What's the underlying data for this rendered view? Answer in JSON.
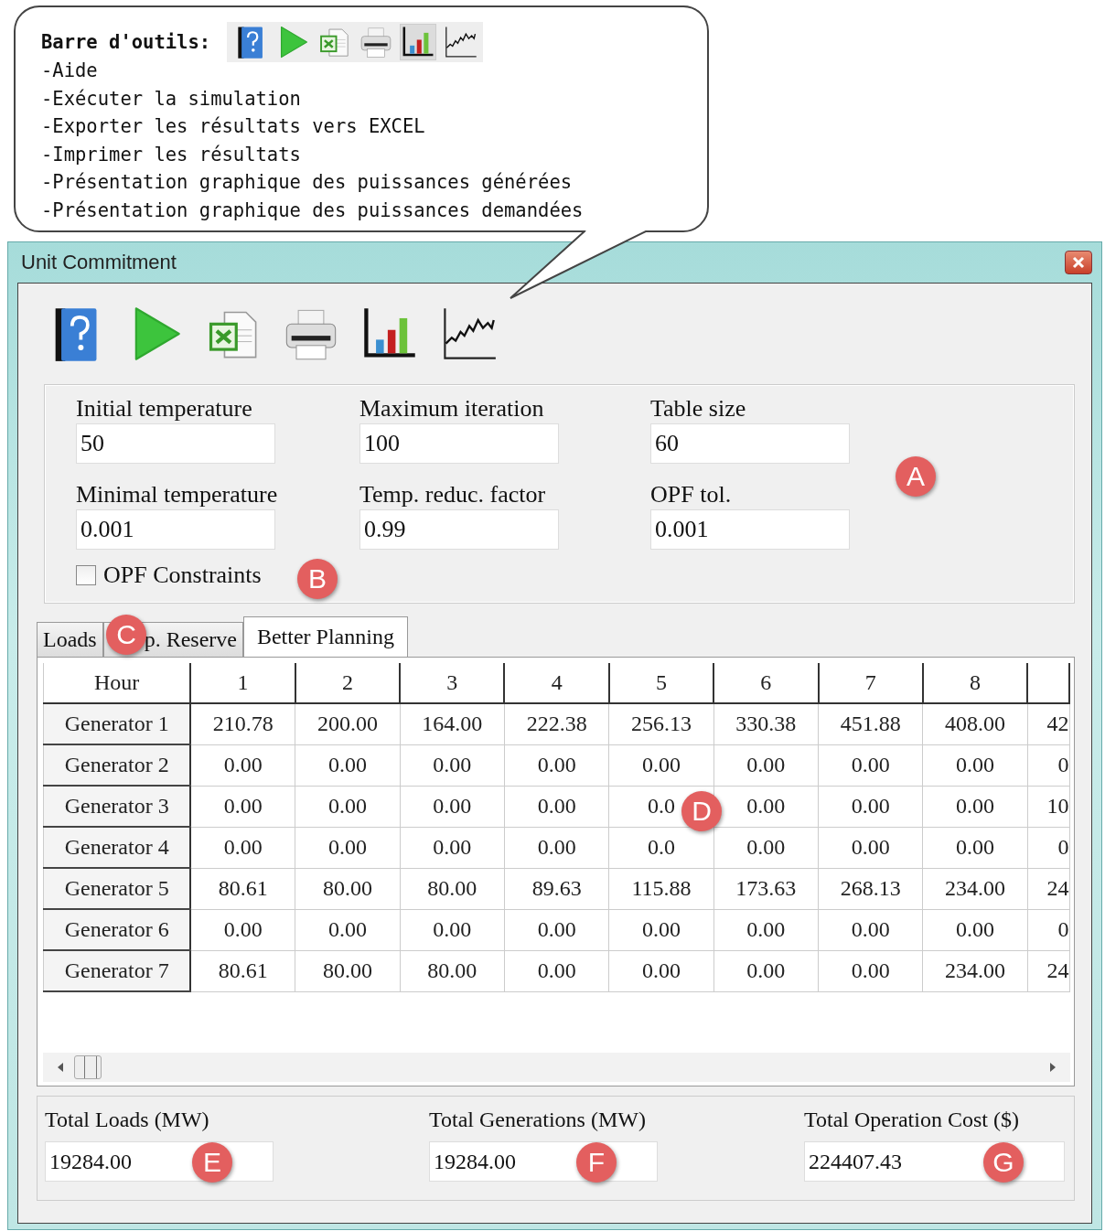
{
  "callout": {
    "heading": "Barre d'outils:",
    "toolbar": [
      {
        "kind": "help",
        "selected": false
      },
      {
        "kind": "run",
        "selected": false
      },
      {
        "kind": "excel",
        "selected": false
      },
      {
        "kind": "print",
        "selected": false
      },
      {
        "kind": "bar-chart",
        "selected": true
      },
      {
        "kind": "line-chart",
        "selected": false
      }
    ],
    "lines": [
      "-Aide",
      "-Exécuter la simulation",
      "-Exporter les résultats vers EXCEL",
      "-Imprimer les résultats",
      "-Présentation graphique des puissances générées",
      "-Présentation graphique des puissances demandées"
    ]
  },
  "window": {
    "title": "Unit Commitment"
  },
  "toolbar": [
    {
      "kind": "help"
    },
    {
      "kind": "run"
    },
    {
      "kind": "excel"
    },
    {
      "kind": "print"
    },
    {
      "kind": "bar-chart"
    },
    {
      "kind": "line-chart"
    }
  ],
  "params": {
    "badge": "A",
    "fields": [
      {
        "label": "Initial temperature",
        "value": "50"
      },
      {
        "label": "Maximum  iteration",
        "value": "100"
      },
      {
        "label": "Table size",
        "value": "60"
      },
      {
        "label": "Minimal temperature",
        "value": "0.001"
      },
      {
        "label": "Temp. reduc. factor",
        "value": "0.99"
      },
      {
        "label": "OPF tol.",
        "value": "0.001"
      }
    ],
    "checkbox": {
      "label": "OPF Constraints",
      "checked": false,
      "badge": "B"
    }
  },
  "tabs": {
    "badge": "C",
    "items": [
      {
        "label": "Loads",
        "selected": false
      },
      {
        "label": "p. Reserve",
        "selected": false
      },
      {
        "label": "Better Planning",
        "selected": true
      }
    ]
  },
  "table": {
    "badge": "D",
    "columns": [
      "Hour",
      "1",
      "2",
      "3",
      "4",
      "5",
      "6",
      "7",
      "8",
      ""
    ],
    "rows": [
      [
        "Generator 1",
        "210.78",
        "200.00",
        "164.00",
        "222.38",
        "256.13",
        "330.38",
        "451.88",
        "408.00",
        "42"
      ],
      [
        "Generator 2",
        "0.00",
        "0.00",
        "0.00",
        "0.00",
        "0.00",
        "0.00",
        "0.00",
        "0.00",
        "0"
      ],
      [
        "Generator 3",
        "0.00",
        "0.00",
        "0.00",
        "0.00",
        "0.0",
        "0.00",
        "0.00",
        "0.00",
        "10"
      ],
      [
        "Generator 4",
        "0.00",
        "0.00",
        "0.00",
        "0.00",
        "0.0",
        "0.00",
        "0.00",
        "0.00",
        "0"
      ],
      [
        "Generator 5",
        "80.61",
        "80.00",
        "80.00",
        "89.63",
        "115.88",
        "173.63",
        "268.13",
        "234.00",
        "24"
      ],
      [
        "Generator 6",
        "0.00",
        "0.00",
        "0.00",
        "0.00",
        "0.00",
        "0.00",
        "0.00",
        "0.00",
        "0"
      ],
      [
        "Generator 7",
        "80.61",
        "80.00",
        "80.00",
        "0.00",
        "0.00",
        "0.00",
        "0.00",
        "234.00",
        "24"
      ]
    ]
  },
  "totals": [
    {
      "label": "Total Loads (MW)",
      "value": "19284.00",
      "badge": "E"
    },
    {
      "label": "Total Generations (MW)",
      "value": "19284.00",
      "badge": "F"
    },
    {
      "label": "Total Operation Cost ($)",
      "value": "224407.43",
      "badge": "G"
    }
  ]
}
